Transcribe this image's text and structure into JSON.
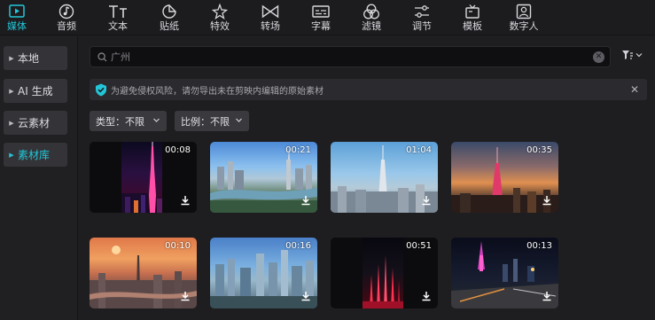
{
  "toolbar": {
    "tabs": [
      {
        "label": "媒体",
        "icon": "media-icon",
        "active": true
      },
      {
        "label": "音频",
        "icon": "audio-icon"
      },
      {
        "label": "文本",
        "icon": "text-icon"
      },
      {
        "label": "贴纸",
        "icon": "sticker-icon"
      },
      {
        "label": "特效",
        "icon": "effects-icon"
      },
      {
        "label": "转场",
        "icon": "transition-icon"
      },
      {
        "label": "字幕",
        "icon": "subtitle-icon"
      },
      {
        "label": "滤镜",
        "icon": "filter-icon"
      },
      {
        "label": "调节",
        "icon": "adjust-icon"
      },
      {
        "label": "模板",
        "icon": "template-icon"
      },
      {
        "label": "数字人",
        "icon": "digital-human-icon"
      }
    ]
  },
  "sidebar": {
    "items": [
      {
        "label": "本地",
        "active": false
      },
      {
        "label": "AI 生成",
        "active": false
      },
      {
        "label": "云素材",
        "active": false
      },
      {
        "label": "素材库",
        "active": true
      }
    ]
  },
  "search": {
    "value": "广州"
  },
  "notice": {
    "text": "为避免侵权风险，请勿导出未在剪映内编辑的原始素材"
  },
  "filters": {
    "type": {
      "label": "类型：",
      "value": "不限"
    },
    "ratio": {
      "label": "比例：",
      "value": "不限"
    }
  },
  "assets": [
    {
      "duration": "00:08",
      "scene": "canton-tower-night-vertical"
    },
    {
      "duration": "00:21",
      "scene": "city-river-aerial-day"
    },
    {
      "duration": "01:04",
      "scene": "canton-tower-day"
    },
    {
      "duration": "00:35",
      "scene": "canton-tower-sunset"
    },
    {
      "duration": "00:10",
      "scene": "sunset-skyline"
    },
    {
      "duration": "00:16",
      "scene": "cbd-skyline-day"
    },
    {
      "duration": "00:51",
      "scene": "fountain-night-vertical"
    },
    {
      "duration": "00:13",
      "scene": "street-night"
    }
  ],
  "colors": {
    "accent": "#22c6d8",
    "background": "#1e1e21",
    "panel": "#343438"
  }
}
